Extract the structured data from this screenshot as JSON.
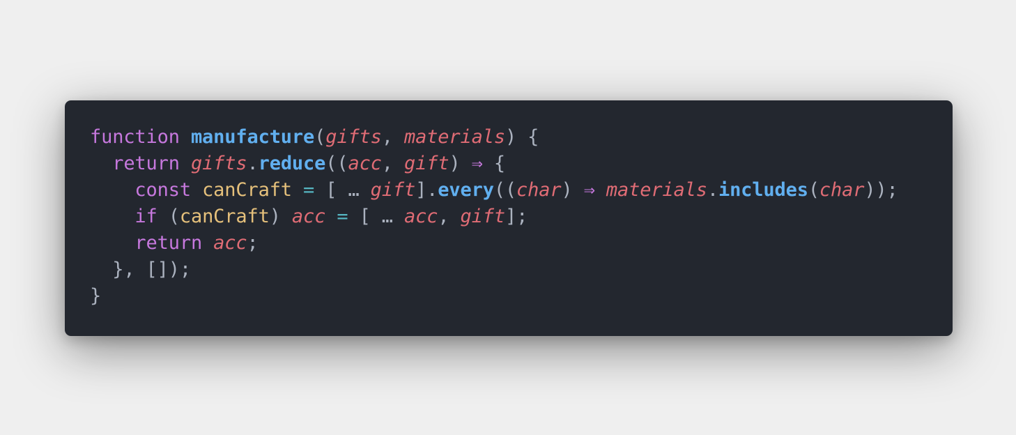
{
  "editor": {
    "colors": {
      "background": "#23272f",
      "page": "#efefef",
      "keyword": "#c678dd",
      "function": "#61afef",
      "variable": "#e5c07b",
      "parameter": "#e06c75",
      "operator": "#56b6c2",
      "punctuation": "#abb2bf"
    },
    "code_lines": [
      {
        "tokens": [
          {
            "t": "kw",
            "v": "function"
          },
          {
            "t": "plain",
            "v": " "
          },
          {
            "t": "fn",
            "v": "manufacture"
          },
          {
            "t": "punc",
            "v": "("
          },
          {
            "t": "param",
            "v": "gifts"
          },
          {
            "t": "punc",
            "v": ", "
          },
          {
            "t": "param",
            "v": "materials"
          },
          {
            "t": "punc",
            "v": ") {"
          }
        ]
      },
      {
        "tokens": [
          {
            "t": "plain",
            "v": "  "
          },
          {
            "t": "kw",
            "v": "return"
          },
          {
            "t": "plain",
            "v": " "
          },
          {
            "t": "param",
            "v": "gifts"
          },
          {
            "t": "punc",
            "v": "."
          },
          {
            "t": "fn",
            "v": "reduce"
          },
          {
            "t": "punc",
            "v": "(("
          },
          {
            "t": "param",
            "v": "acc"
          },
          {
            "t": "punc",
            "v": ", "
          },
          {
            "t": "param",
            "v": "gift"
          },
          {
            "t": "punc",
            "v": ") "
          },
          {
            "t": "arrow",
            "v": "⇒"
          },
          {
            "t": "punc",
            "v": " {"
          }
        ]
      },
      {
        "tokens": [
          {
            "t": "plain",
            "v": "    "
          },
          {
            "t": "kw",
            "v": "const"
          },
          {
            "t": "plain",
            "v": " "
          },
          {
            "t": "var",
            "v": "canCraft"
          },
          {
            "t": "plain",
            "v": " "
          },
          {
            "t": "op",
            "v": "="
          },
          {
            "t": "plain",
            "v": " "
          },
          {
            "t": "punc",
            "v": "[ … "
          },
          {
            "t": "param",
            "v": "gift"
          },
          {
            "t": "punc",
            "v": "]."
          },
          {
            "t": "fn",
            "v": "every"
          },
          {
            "t": "punc",
            "v": "(("
          },
          {
            "t": "param",
            "v": "char"
          },
          {
            "t": "punc",
            "v": ") "
          },
          {
            "t": "arrow",
            "v": "⇒"
          },
          {
            "t": "plain",
            "v": " "
          },
          {
            "t": "param",
            "v": "materials"
          },
          {
            "t": "punc",
            "v": "."
          },
          {
            "t": "fn",
            "v": "includes"
          },
          {
            "t": "punc",
            "v": "("
          },
          {
            "t": "param",
            "v": "char"
          },
          {
            "t": "punc",
            "v": "));"
          }
        ]
      },
      {
        "tokens": [
          {
            "t": "plain",
            "v": "    "
          },
          {
            "t": "kw",
            "v": "if"
          },
          {
            "t": "punc",
            "v": " ("
          },
          {
            "t": "var",
            "v": "canCraft"
          },
          {
            "t": "punc",
            "v": ") "
          },
          {
            "t": "param",
            "v": "acc"
          },
          {
            "t": "plain",
            "v": " "
          },
          {
            "t": "op",
            "v": "="
          },
          {
            "t": "plain",
            "v": " "
          },
          {
            "t": "punc",
            "v": "[ … "
          },
          {
            "t": "param",
            "v": "acc"
          },
          {
            "t": "punc",
            "v": ", "
          },
          {
            "t": "param",
            "v": "gift"
          },
          {
            "t": "punc",
            "v": "];"
          }
        ]
      },
      {
        "tokens": [
          {
            "t": "plain",
            "v": "    "
          },
          {
            "t": "kw",
            "v": "return"
          },
          {
            "t": "plain",
            "v": " "
          },
          {
            "t": "param",
            "v": "acc"
          },
          {
            "t": "punc",
            "v": ";"
          }
        ]
      },
      {
        "tokens": [
          {
            "t": "plain",
            "v": "  "
          },
          {
            "t": "punc",
            "v": "}, []);"
          }
        ]
      },
      {
        "tokens": [
          {
            "t": "punc",
            "v": "}"
          }
        ]
      }
    ]
  }
}
